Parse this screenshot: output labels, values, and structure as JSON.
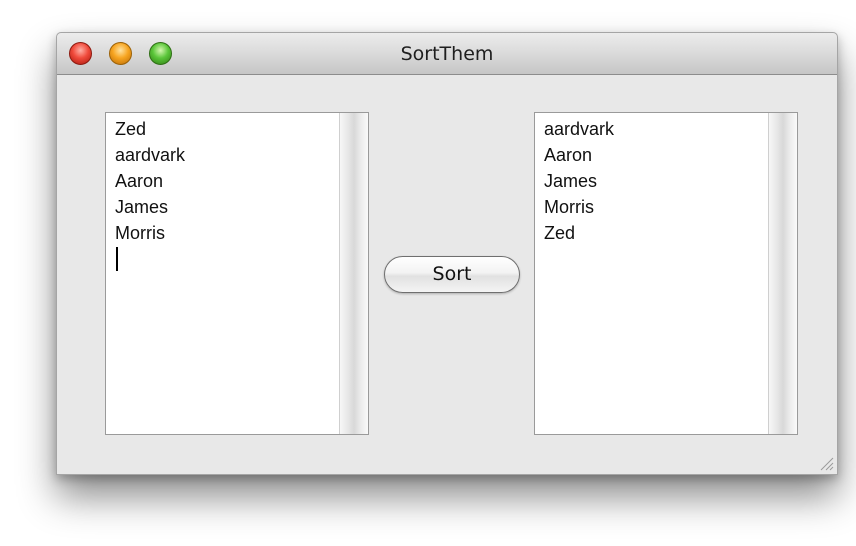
{
  "window": {
    "title": "SortThem"
  },
  "input_list": {
    "lines": [
      "Zed",
      "aardvark",
      "Aaron",
      "James",
      "Morris"
    ]
  },
  "output_list": {
    "lines": [
      "aardvark",
      "Aaron",
      "James",
      "Morris",
      "Zed"
    ]
  },
  "sort_button": {
    "label": "Sort"
  },
  "icons": {
    "close": "close-button-red",
    "minimize": "minimize-button-yellow",
    "zoom": "zoom-button-green",
    "resize": "resize-grip-icon"
  },
  "colors": {
    "close": "#f04b3c",
    "minimize": "#f7a521",
    "zoom": "#5bc63a",
    "window_bg": "#e8e8e8"
  }
}
